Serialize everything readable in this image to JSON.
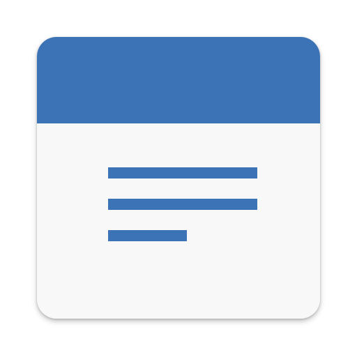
{
  "icon": {
    "name": "notes-app-icon",
    "colors": {
      "header": "#3B73B6",
      "body": "#F8F8F8",
      "lines": "#3B73B6"
    },
    "lines": [
      {
        "name": "text-line-1"
      },
      {
        "name": "text-line-2"
      },
      {
        "name": "text-line-3"
      }
    ]
  }
}
